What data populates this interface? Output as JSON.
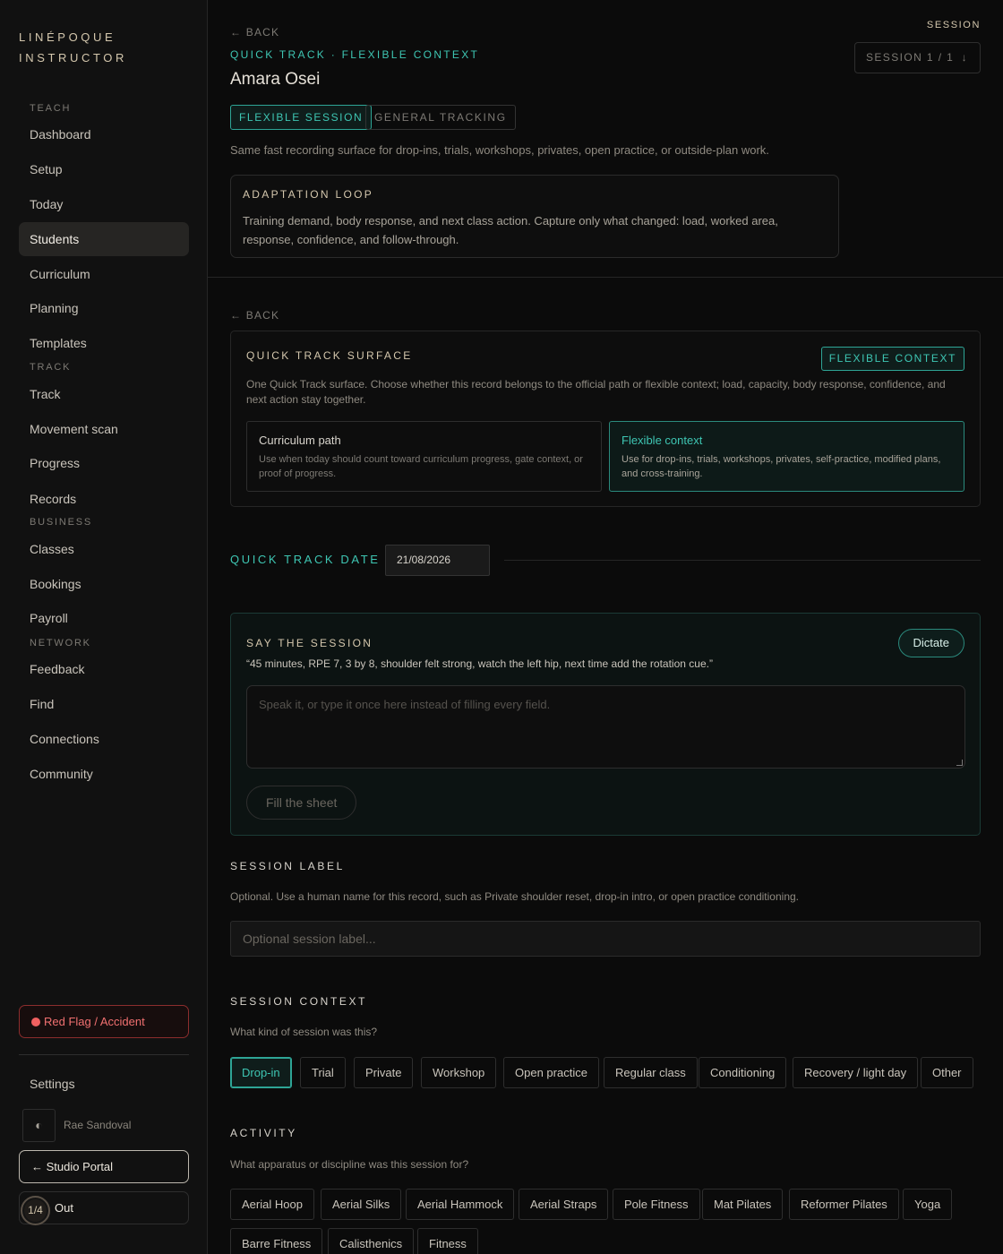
{
  "brand": {
    "line1": "LINÉPOQUE",
    "line2": "INSTRUCTOR"
  },
  "sidebar": {
    "sections": {
      "teach": "TEACH",
      "track": "TRACK",
      "business": "BUSINESS",
      "network": "NETWORK"
    },
    "items": [
      {
        "label": "Dashboard"
      },
      {
        "label": "Setup"
      },
      {
        "label": "Today"
      },
      {
        "label": "Students",
        "active": true
      },
      {
        "label": "Curriculum"
      },
      {
        "label": "Planning"
      },
      {
        "label": "Templates"
      },
      {
        "label": "Track"
      },
      {
        "label": "Movement scan"
      },
      {
        "label": "Progress"
      },
      {
        "label": "Records"
      },
      {
        "label": "Classes"
      },
      {
        "label": "Bookings"
      },
      {
        "label": "Payroll"
      },
      {
        "label": "Feedback"
      },
      {
        "label": "Find"
      },
      {
        "label": "Connections"
      },
      {
        "label": "Community"
      }
    ],
    "red_flag": "Red Flag / Accident",
    "settings": "Settings",
    "theme_icon": "◐",
    "user_name": "Rae Sandoval",
    "studio_portal": "← Studio Portal",
    "out": "Out",
    "page_badge": "1/4"
  },
  "header": {
    "back": "← BACK",
    "kicker": "QUICK TRACK · FLEXIBLE CONTEXT",
    "student": "Amara Osei",
    "session_label": "SESSION",
    "session_select": "SESSION 1 / 1",
    "session_arrow": "↓",
    "tags": [
      "FLEXIBLE SESSION",
      "GENERAL TRACKING"
    ],
    "description": "Same fast recording surface for drop-ins, trials, workshops, privates, open practice, or outside-plan work."
  },
  "adaptation": {
    "heading": "ADAPTATION LOOP",
    "text": "Training demand, body response, and next class action. Capture only what changed: load, worked area, response, confidence, and follow-through."
  },
  "surface": {
    "back": "← BACK",
    "heading": "QUICK TRACK SURFACE",
    "pill": "FLEXIBLE CONTEXT",
    "description": "One Quick Track surface. Choose whether this record belongs to the official path or flexible context; load, capacity, body response, confidence, and next action stay together.",
    "options": [
      {
        "title": "Curriculum path",
        "desc": "Use when today should count toward curriculum progress, gate context, or proof of progress."
      },
      {
        "title": "Flexible context",
        "desc": "Use for drop-ins, trials, workshops, privates, self-practice, modified plans, and cross-training.",
        "selected": true
      }
    ]
  },
  "date": {
    "label": "QUICK TRACK DATE",
    "value": "21/08/2026"
  },
  "say": {
    "heading": "SAY THE SESSION",
    "dictate": "Dictate",
    "example": "“45 minutes, RPE 7, 3 by 8, shoulder felt strong, watch the left hip, next time add the rotation cue.”",
    "placeholder": "Speak it, or type it once here instead of filling every field.",
    "fill_button": "Fill the sheet"
  },
  "session_label": {
    "heading": "SESSION LABEL",
    "desc": "Optional. Use a human name for this record, such as Private shoulder reset, drop-in intro, or open practice conditioning.",
    "placeholder": "Optional session label..."
  },
  "session_context": {
    "heading": "SESSION CONTEXT",
    "desc": "What kind of session was this?",
    "options": [
      "Drop-in",
      "Trial",
      "Private",
      "Workshop",
      "Open practice",
      "Regular class",
      "Conditioning",
      "Recovery / light day",
      "Other"
    ],
    "selected": "Drop-in"
  },
  "activity": {
    "heading": "ACTIVITY",
    "desc": "What apparatus or discipline was this session for?",
    "options": [
      "Aerial Hoop",
      "Aerial Silks",
      "Aerial Hammock",
      "Aerial Straps",
      "Pole Fitness",
      "Mat Pilates",
      "Reformer Pilates",
      "Yoga",
      "Barre Fitness",
      "Calisthenics",
      "Fitness"
    ]
  }
}
